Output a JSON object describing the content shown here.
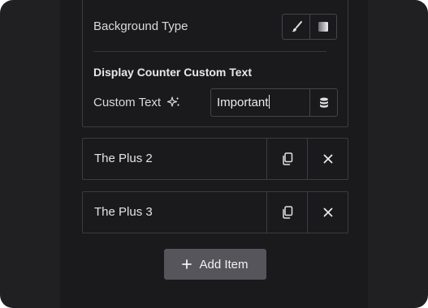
{
  "background_section": {
    "label": "Background Type",
    "buttons": [
      "brush-icon",
      "gradient-icon"
    ]
  },
  "counter_text": {
    "heading": "Display Counter Custom Text",
    "label": "Custom Text",
    "value": "Important",
    "ai_icon": "sparkle-icon",
    "dynamic_icon": "database-icon"
  },
  "items": [
    {
      "title": "The Plus 2"
    },
    {
      "title": "The Plus 3"
    }
  ],
  "add_button": {
    "label": "Add Item"
  },
  "colors": {
    "window_bg": "#202023",
    "panel_bg": "#1a1a1c",
    "border": "#3c3c40",
    "button_bg": "#55555b"
  }
}
